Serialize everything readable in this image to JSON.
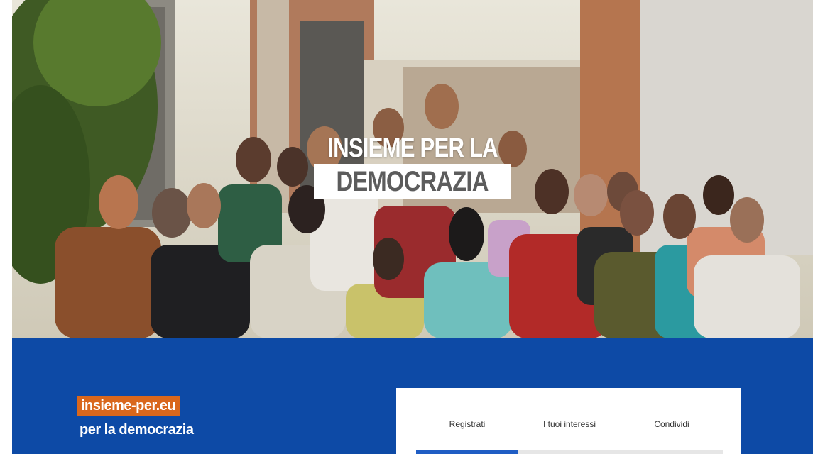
{
  "hero": {
    "title_line1": "INSIEME PER LA",
    "title_line2": "DEMOCRAZIA"
  },
  "brand": {
    "tag": "insieme-per.eu",
    "subtitle": "per la democrazia",
    "accent_color": "#d9671c",
    "band_color": "#0d4aa6"
  },
  "card": {
    "tabs": [
      {
        "label": "Registrati",
        "active": true
      },
      {
        "label": "I tuoi interessi",
        "active": false
      },
      {
        "label": "Condividi",
        "active": false
      }
    ],
    "active_color": "#1f5dc4"
  }
}
